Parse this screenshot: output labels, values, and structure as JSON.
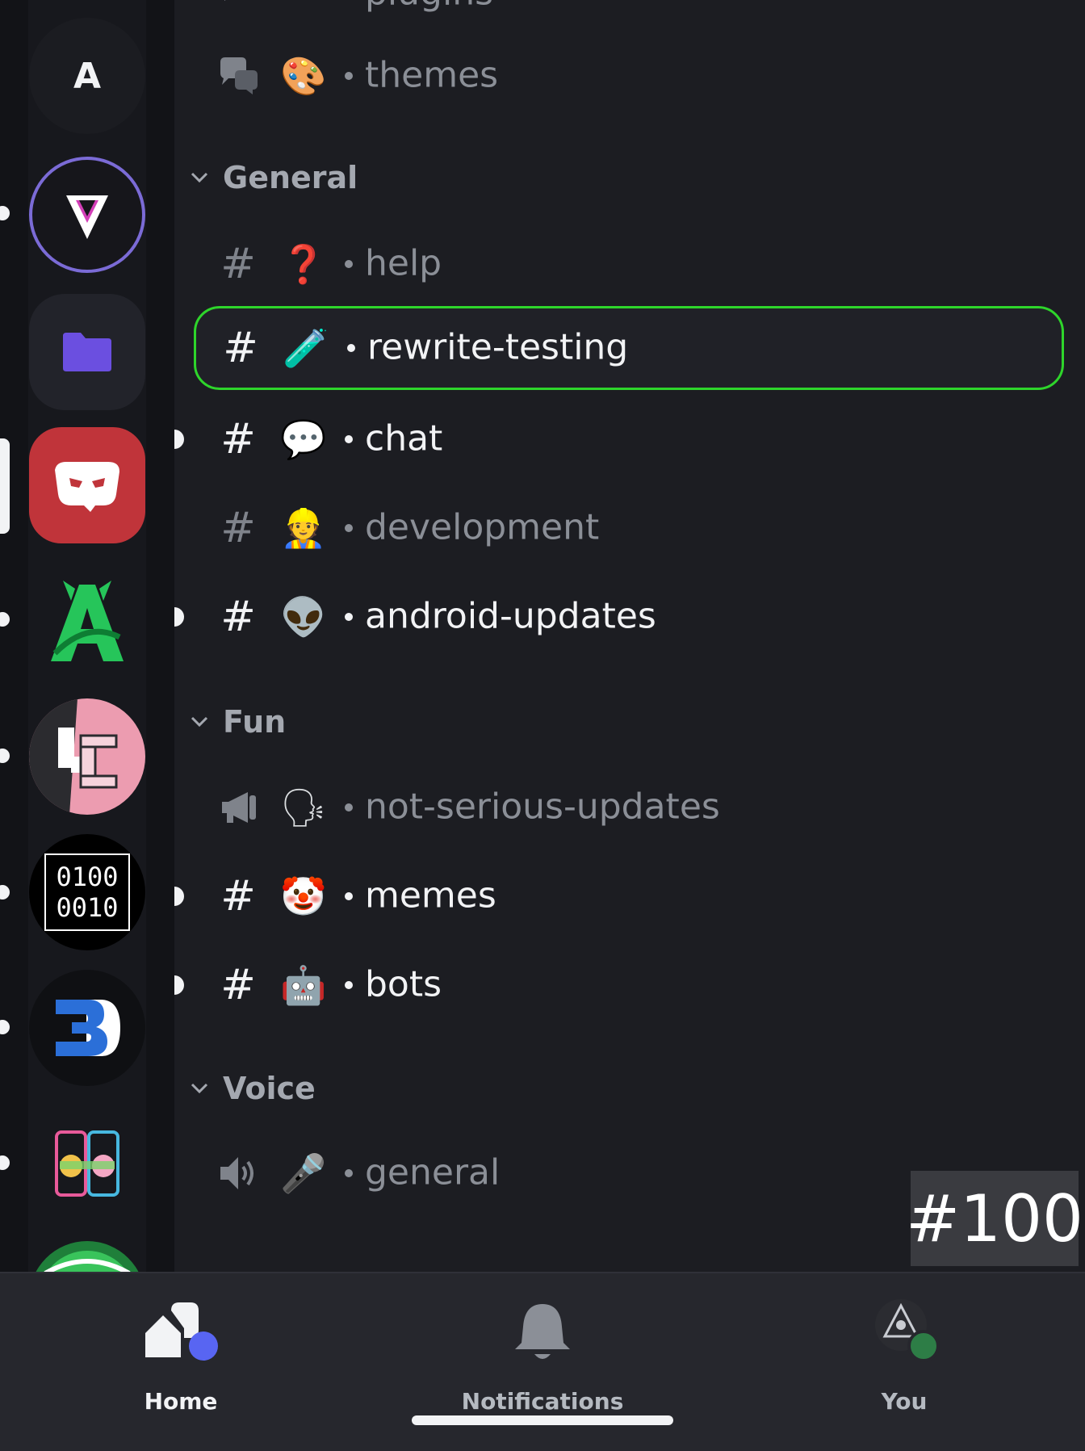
{
  "servers": [
    {
      "label": "A",
      "indicator": "none"
    },
    {
      "label": "V",
      "indicator": "dot"
    },
    {
      "label": "folder",
      "indicator": "none"
    },
    {
      "label": "mask",
      "indicator": "bar"
    },
    {
      "label": "A",
      "indicator": "dot"
    },
    {
      "label": "VC",
      "indicator": "dot"
    },
    {
      "label_line1": "0100",
      "label_line2": "0010",
      "indicator": "dot"
    },
    {
      "label": "B",
      "indicator": "dot"
    },
    {
      "label": "phones",
      "indicator": "dot"
    }
  ],
  "channels": {
    "top_partial": {
      "name": "plugins",
      "type": "forum-icon"
    },
    "themes": {
      "emoji": "🎨",
      "name": "themes",
      "type": "forum-icon"
    },
    "categories": {
      "general": "General",
      "fun": "Fun",
      "voice": "Voice"
    },
    "help": {
      "emoji": "❓",
      "name": "help",
      "type": "#"
    },
    "rewrite_testing": {
      "emoji": "🧪",
      "name": "rewrite-testing",
      "type": "#"
    },
    "chat": {
      "emoji": "💬",
      "name": "chat",
      "type": "#"
    },
    "development": {
      "emoji": "👷",
      "name": "development",
      "type": "#"
    },
    "android_updates": {
      "emoji": "👽",
      "name": "android-updates",
      "type": "#"
    },
    "not_serious_updates": {
      "emoji": "🗣",
      "name": "not-serious-updates",
      "type": "announcement-icon"
    },
    "memes": {
      "emoji": "🤡",
      "name": "memes",
      "type": "#"
    },
    "bots": {
      "emoji": "🤖",
      "name": "bots",
      "type": "#"
    },
    "general_voice": {
      "emoji": "🎤",
      "name": "general",
      "type": "speaker-icon"
    }
  },
  "badge": "#100",
  "nav": {
    "home": "Home",
    "notifications": "Notifications",
    "you": "You"
  },
  "colors": {
    "selection_outline": "#2ed52b",
    "background": "#1c1d22",
    "rail": "#121317",
    "unread_text": "#f2f3f5",
    "muted_text": "#8b8f97",
    "status_online": "#2d7d46",
    "home_badge": "#5865f2"
  }
}
